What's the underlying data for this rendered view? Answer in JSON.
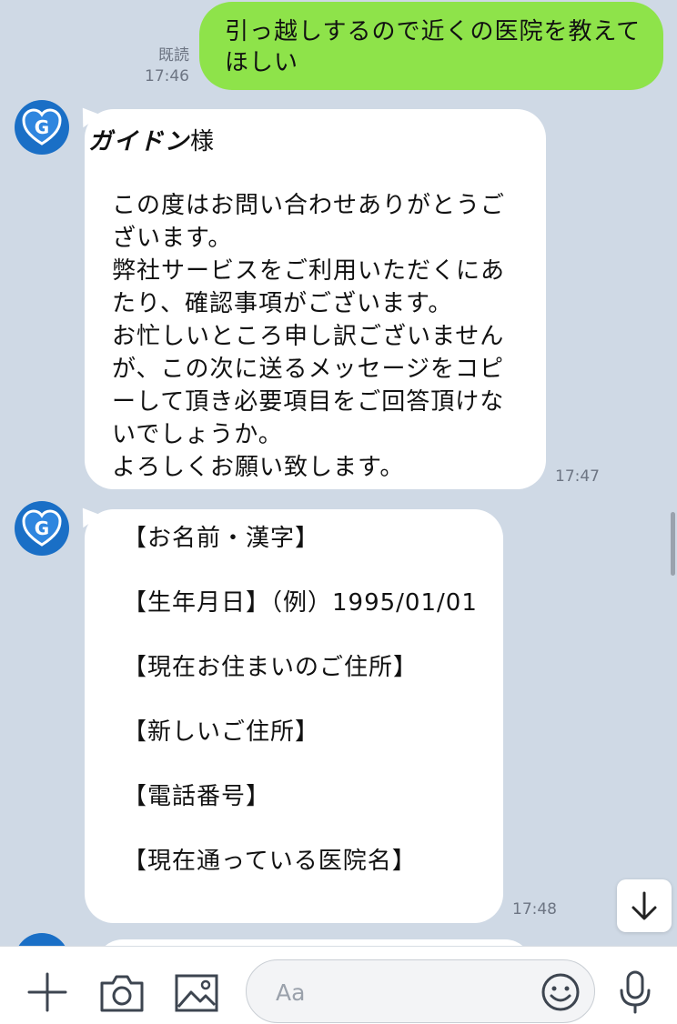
{
  "messages": {
    "outgoing": {
      "text": "引っ越しするので近くの医院を教えてほしい",
      "read_label": "既読",
      "time": "17:46"
    },
    "incoming": [
      {
        "avatar_letter": "G",
        "name": "ガイドン",
        "honorific": "様",
        "body": "この度はお問い合わせありがとうご\nざいます。\n弊社サービスをご利用いただくにあ\nたり、確認事項がございます。\nお忙しいところ申し訳ございません\nが、この次に送るメッセージをコピ\nーして頂き必要項目をご回答頂けな\nいでしょうか。\nよろしくお願い致します。",
        "time": "17:47"
      },
      {
        "avatar_letter": "G",
        "fields": [
          "【お名前・漢字】",
          "【生年月日】（例）1995/01/01",
          "【現在お住まいのご住所】",
          "【新しいご住所】",
          "【電話番号】",
          "【現在通っている医院名】"
        ],
        "time": "17:48"
      }
    ]
  },
  "input_bar": {
    "placeholder": "Aa",
    "icons": [
      "plus-icon",
      "camera-icon",
      "image-icon",
      "emoji-icon",
      "microphone-icon"
    ]
  },
  "controls": {
    "scroll_down_icon": "arrow-down-icon"
  },
  "colors": {
    "background": "#cfd9e5",
    "outgoing_bubble": "#8ee34a",
    "incoming_bubble": "#ffffff",
    "avatar": "#1a6fc6"
  }
}
